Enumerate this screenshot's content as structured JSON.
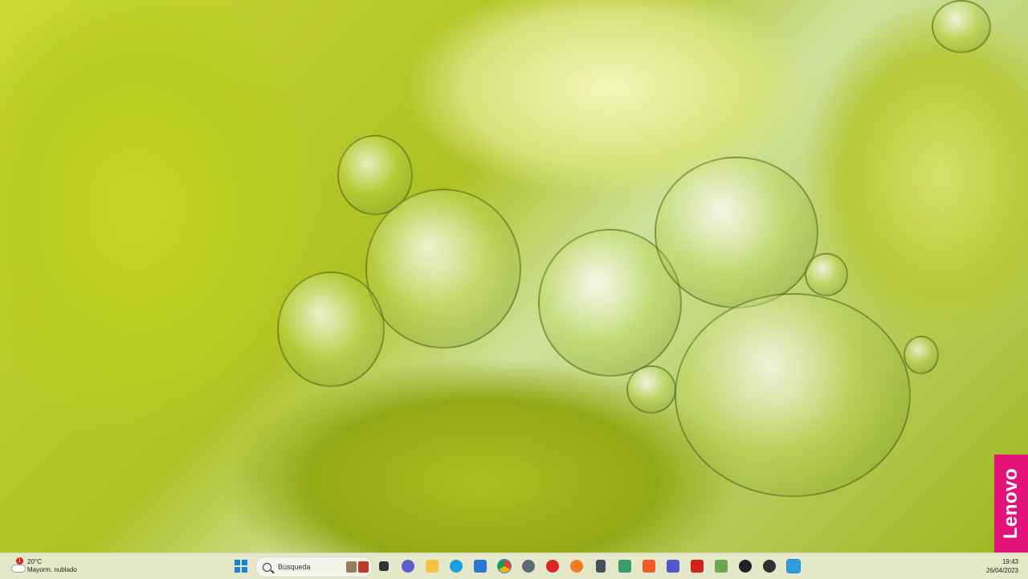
{
  "desktop": {
    "wallpaper": "green-oil-bubbles",
    "brand_badge": "Lenovo",
    "brand_color": "#e2147a"
  },
  "taskbar": {
    "weather": {
      "temperature": "20°C",
      "condition": "Mayorm. nublado",
      "alert_count": "1",
      "icon": "cloud-icon"
    },
    "start_icon": "windows-start-icon",
    "search": {
      "placeholder": "Búsqueda",
      "icon": "search-icon"
    },
    "apps": [
      {
        "name": "task-view",
        "color": "#333333"
      },
      {
        "name": "teams-chat",
        "color": "#5b5fc7"
      },
      {
        "name": "file-explorer",
        "color": "#f5c242"
      },
      {
        "name": "edge",
        "color": "#1a9ee0"
      },
      {
        "name": "microsoft-store",
        "color": "#2b78d4"
      },
      {
        "name": "chrome",
        "color": "#db4437"
      },
      {
        "name": "settings",
        "color": "#5e6b78"
      },
      {
        "name": "opera",
        "color": "#e0242b"
      },
      {
        "name": "firefox",
        "color": "#f07b23"
      },
      {
        "name": "calculator",
        "color": "#44505c"
      },
      {
        "name": "paint",
        "color": "#3a9c6a"
      },
      {
        "name": "brave",
        "color": "#f05a24"
      },
      {
        "name": "teams",
        "color": "#5059c9"
      },
      {
        "name": "acrobat",
        "color": "#d32020"
      },
      {
        "name": "notepad",
        "color": "#6aa84f"
      },
      {
        "name": "media-player",
        "color": "#222222"
      },
      {
        "name": "obs",
        "color": "#303030"
      },
      {
        "name": "grid-app",
        "color": "#2d9cdb"
      }
    ],
    "clock": {
      "time": "19:43",
      "date": "26/04/2023"
    }
  }
}
